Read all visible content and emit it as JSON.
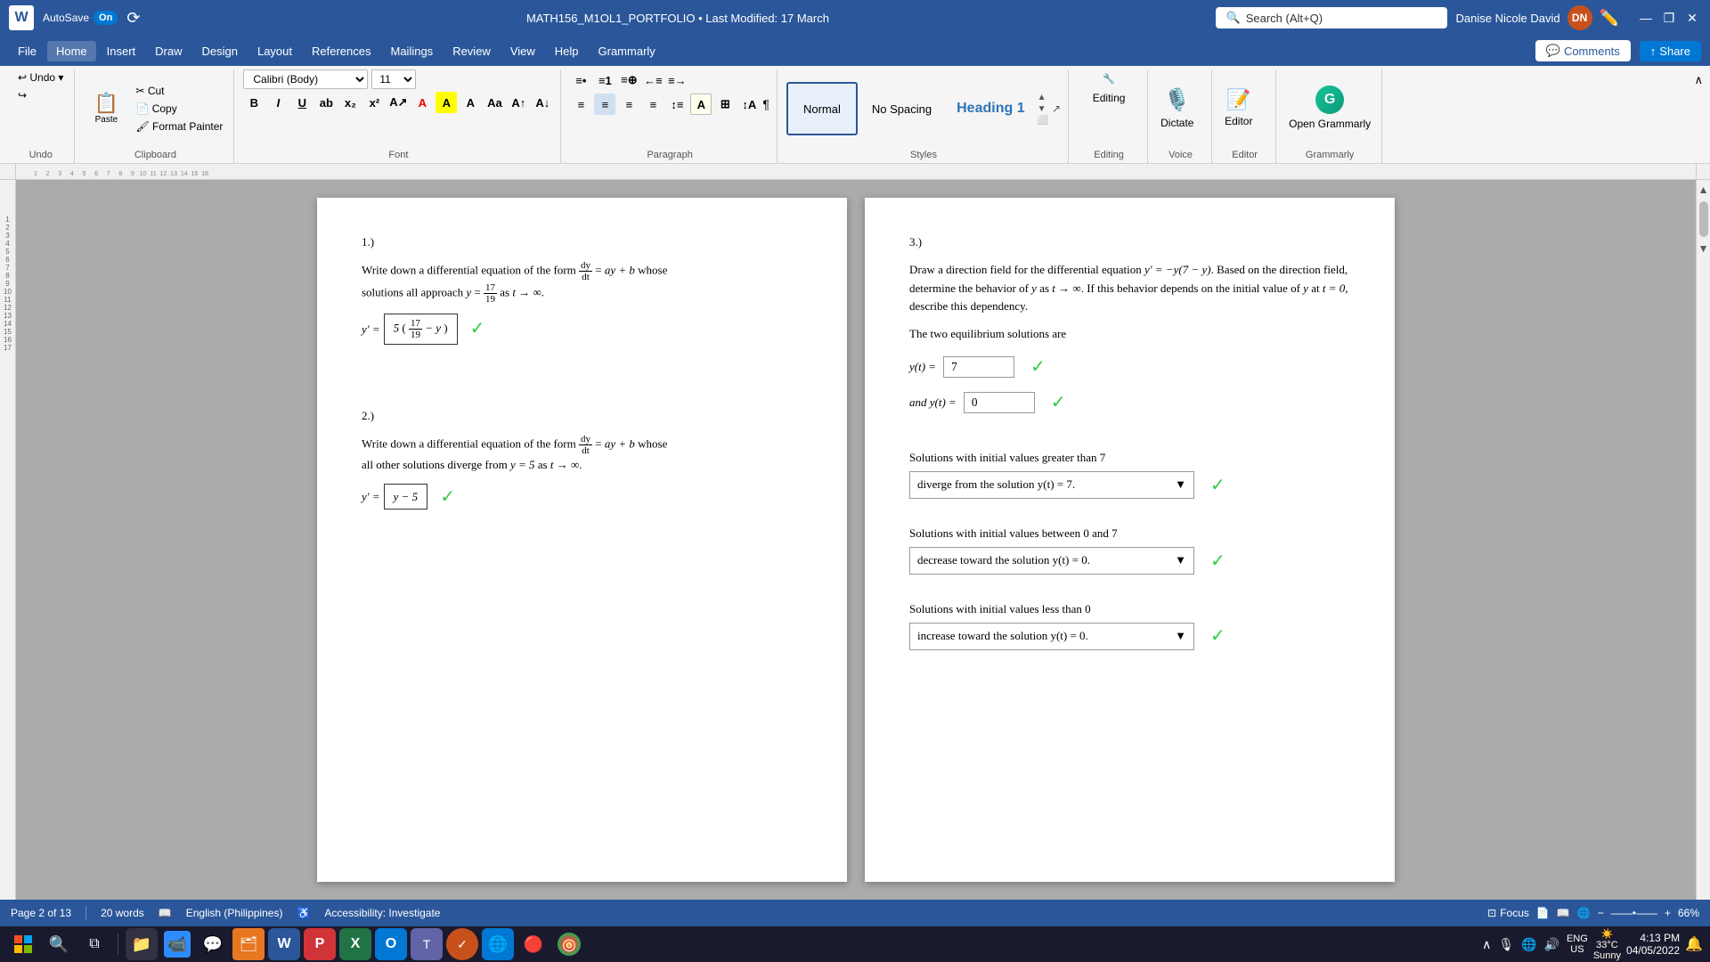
{
  "titlebar": {
    "word_icon": "W",
    "autosave_label": "AutoSave",
    "toggle_label": "On",
    "title": "MATH156_M1OL1_PORTFOLIO • Last Modified: 17 March",
    "search_placeholder": "Search (Alt+Q)",
    "username": "Danise Nicole David",
    "avatar": "DN",
    "minimize": "—",
    "maximize": "❐",
    "close": "✕"
  },
  "menubar": {
    "items": [
      "File",
      "Home",
      "Insert",
      "Draw",
      "Design",
      "Layout",
      "References",
      "Mailings",
      "Review",
      "View",
      "Help",
      "Grammarly"
    ],
    "active": "Home",
    "comments_btn": "Comments",
    "share_btn": "Share"
  },
  "ribbon": {
    "undo_label": "Undo",
    "clipboard_label": "Clipboard",
    "font_label": "Font",
    "paragraph_label": "Paragraph",
    "styles_label": "Styles",
    "voice_label": "Voice",
    "editor_label": "Editor",
    "grammarly_label": "Grammarly",
    "font_name": "Calibri (Body)",
    "font_size": "11",
    "paste_label": "Paste",
    "cut_label": "Cut",
    "copy_label": "Copy",
    "format_painter_label": "Format Painter",
    "bold": "B",
    "italic": "I",
    "underline": "U",
    "styles": {
      "normal": "Normal",
      "no_spacing": "No Spacing",
      "heading1": "Heading 1"
    },
    "editing_label": "Editing",
    "dictate_label": "Dictate",
    "editor_btn_label": "Editor",
    "open_grammarly": "Open Grammarly"
  },
  "document": {
    "page_left": {
      "problem1": {
        "num": "1.)",
        "text_before": "Write down a differential equation of the form",
        "fraction": "dy/dt",
        "text_after": "= ay + b whose",
        "text2": "solutions all approach",
        "target": "y = 17/19",
        "text3": "as t → ∞.",
        "answer": "y′ = 5(17/19 − y)"
      },
      "problem2": {
        "num": "2.)",
        "text_before": "Write down a differential equation of the form",
        "fraction": "dy/dt",
        "text_after": "= ay + b whose",
        "text2": "all other solutions diverge from y = 5 as t → ∞.",
        "answer": "y′ = y − 5"
      }
    },
    "page_right": {
      "problem3": {
        "num": "3.)",
        "description": "Draw a direction field for the differential equation y′ = −y(7 − y). Based on the direction field, determine the behavior of y as t → ∞. If this behavior depends on the initial value of y at t = 0, describe this dependency.",
        "equilibrium_title": "The two equilibrium solutions are",
        "eq1_label": "y(t) =",
        "eq1_value": "7",
        "eq2_label": "and y(t) =",
        "eq2_value": "0",
        "section1_title": "Solutions with initial values greater than 7",
        "section1_dropdown": "diverge from the solution y(t) = 7.",
        "section2_title": "Solutions with initial values between 0 and 7",
        "section2_dropdown": "decrease toward the solution y(t) = 0.",
        "section3_title": "Solutions with initial values less than 0",
        "section3_dropdown": "increase toward the solution y(t) = 0."
      }
    }
  },
  "statusbar": {
    "page_info": "Page 2 of 13",
    "word_count": "20 words",
    "language": "English (Philippines)",
    "accessibility": "Accessibility: Investigate",
    "focus_btn": "Focus",
    "zoom": "66%"
  },
  "taskbar": {
    "weather_temp": "33°C",
    "weather_desc": "Sunny",
    "time": "4:13 PM",
    "date": "04/05/2022",
    "lang": "ENG\nUS"
  }
}
